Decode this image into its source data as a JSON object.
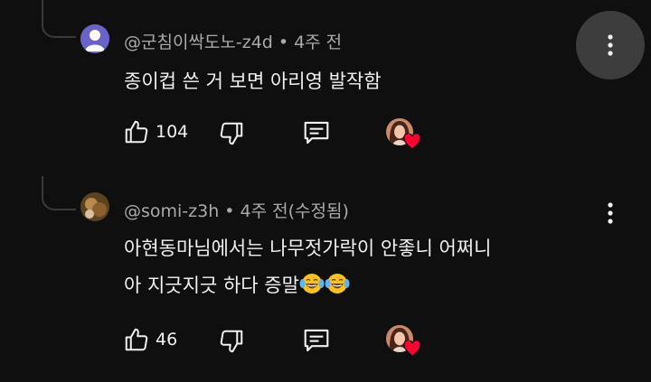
{
  "comments": [
    {
      "author": "@군침이싹도노-z4d",
      "time": "4주 전",
      "text_lines": [
        "종이컵 쓴 거 보면 아리영 발작함"
      ],
      "likes": "104",
      "icons": [
        "thumbs-up-icon",
        "thumbs-down-icon",
        "reply-icon",
        "creator-heart-icon",
        "more-vert-icon"
      ]
    },
    {
      "author": "@somi-z3h",
      "time": "4주 전(수정됨)",
      "text_lines": [
        "아현동마님에서는 나무젓가락이 안좋니 어쩌니",
        "아 지긋지긋 하다 증말"
      ],
      "emojis": [
        "😂",
        "😂"
      ],
      "likes": "46",
      "icons": [
        "thumbs-up-icon",
        "thumbs-down-icon",
        "reply-icon",
        "creator-heart-icon",
        "more-vert-icon"
      ]
    }
  ],
  "colors": {
    "background": "#0f0f0f",
    "text": "#f1f1f1",
    "meta": "#aaaaaa",
    "heart": "#ff0033",
    "menu_bg": "#3d3d3d"
  }
}
